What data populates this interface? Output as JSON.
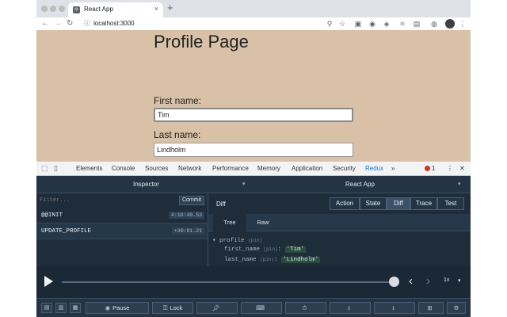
{
  "browser": {
    "tab_title": "React App",
    "tab_favicon": "react-icon",
    "tab_close": "×",
    "new_tab": "+",
    "url": "localhost:3000",
    "nav": {
      "back": "←",
      "forward": "→",
      "reload": "↻"
    },
    "toolbar_icons": [
      "zoom-icon",
      "star-icon",
      "extension-icon",
      "redux-extension-icon",
      "extension-icon",
      "react-extension-icon",
      "profile-icon"
    ]
  },
  "page": {
    "title": "Profile Page",
    "first_name_label": "First name:",
    "first_name_value": "Tim",
    "last_name_label": "Last name:",
    "last_name_value": "Lindholm"
  },
  "devtools": {
    "tabs": [
      "Elements",
      "Console",
      "Sources",
      "Network",
      "Performance",
      "Memory",
      "Application",
      "Security",
      "Redux"
    ],
    "active_tab": "Redux",
    "more": "»",
    "error_count": "1",
    "menu": "⋮",
    "close": "✕"
  },
  "redux": {
    "inspector_label": "Inspector",
    "instance_label": "React App",
    "filter_placeholder": "Filter...",
    "commit_label": "Commit",
    "actions": [
      {
        "name": "@@INIT",
        "time": "4:10:40.53"
      },
      {
        "name": "UPDATE_PROFILE",
        "time": "+30:01.21"
      }
    ],
    "monitor_title": "Diff",
    "monitor_buttons": [
      "Action",
      "State",
      "Diff",
      "Trace",
      "Test"
    ],
    "active_monitor": "Diff",
    "subtabs": [
      "Tree",
      "Raw"
    ],
    "active_subtab": "Tree",
    "diff_tree": {
      "root_key": "profile",
      "root_type": "(pin)",
      "rows": [
        {
          "key": "first_name",
          "type": "(pin)",
          "value": "'Tim'"
        },
        {
          "key": "last_name",
          "type": "(pin)",
          "value": "'Lindholm'"
        }
      ]
    },
    "player": {
      "speed": "1x"
    },
    "bottom": {
      "pause_label": "Pause",
      "lock_label": "Lock"
    }
  },
  "colors": {
    "page_bg": "#d8c1a6",
    "redux_bg": "#1f2d3a",
    "active_blue": "#1a73e8"
  }
}
